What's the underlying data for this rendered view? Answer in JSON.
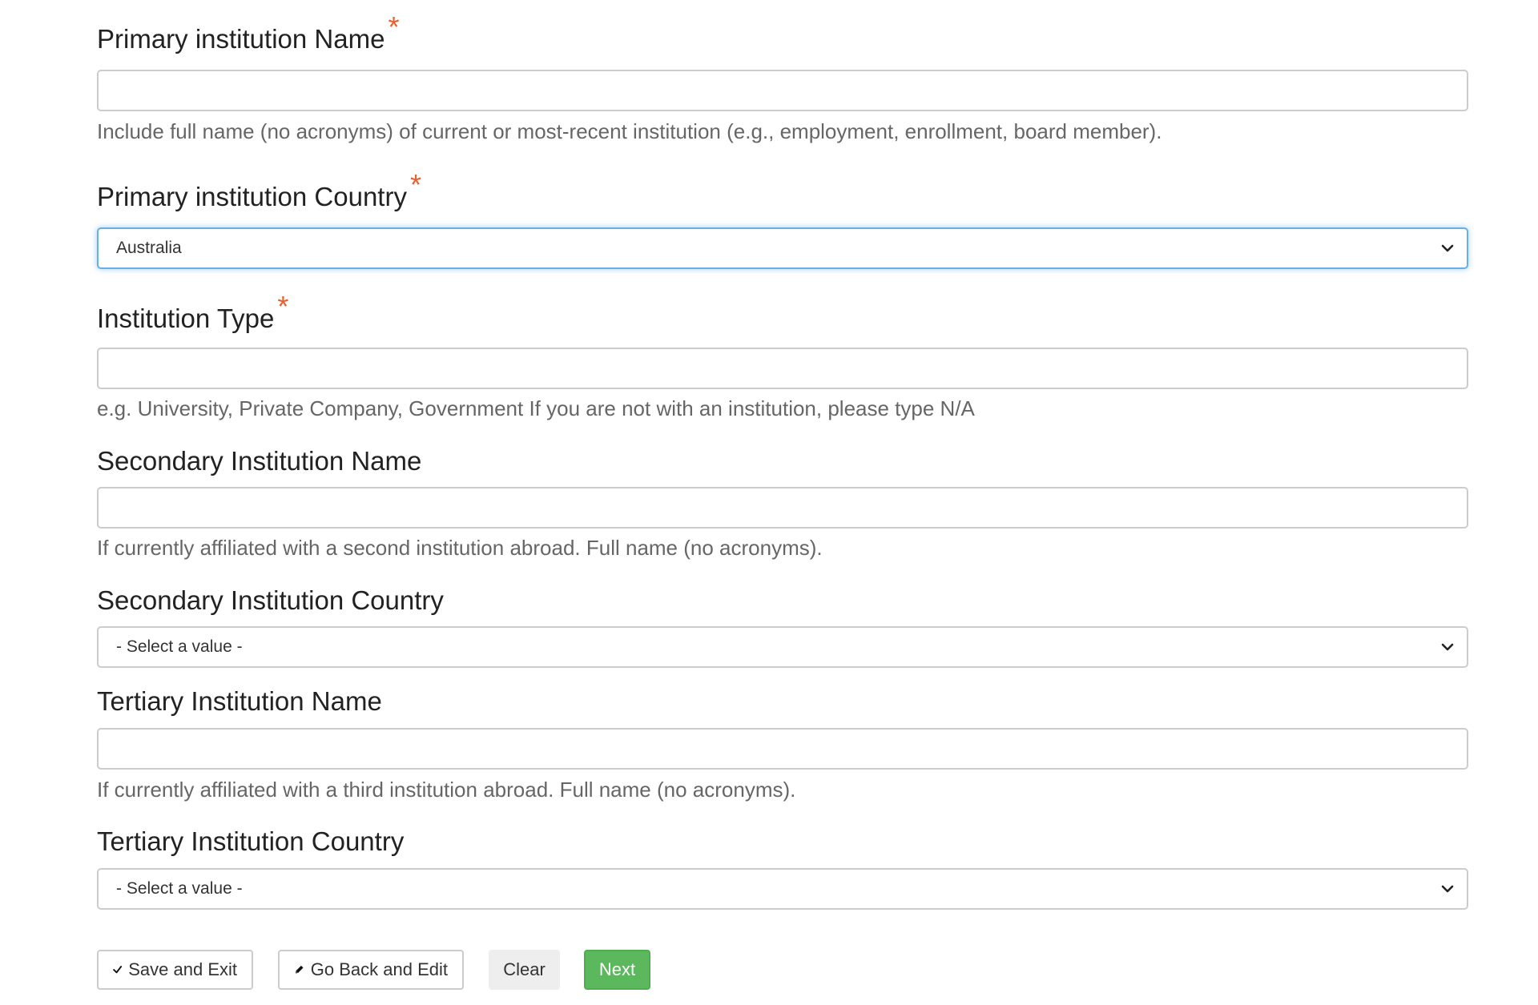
{
  "required_mark": "*",
  "fields": {
    "primary_name": {
      "label": "Primary institution Name",
      "value": "",
      "help": "Include full name (no acronyms) of current or most-recent institution (e.g., employment, enrollment, board member)."
    },
    "primary_country": {
      "label": "Primary institution Country",
      "selected": "Australia"
    },
    "institution_type": {
      "label": "Institution Type",
      "value": "",
      "help": "e.g. University, Private Company, Government If you are not with an institution, please type N/A"
    },
    "secondary_name": {
      "label": "Secondary Institution Name",
      "value": "",
      "help": "If currently affiliated with a second institution abroad. Full name (no acronyms)."
    },
    "secondary_country": {
      "label": "Secondary Institution Country",
      "selected": "- Select a value -"
    },
    "tertiary_name": {
      "label": "Tertiary Institution Name",
      "value": "",
      "help": "If currently affiliated with a third institution abroad. Full name (no acronyms)."
    },
    "tertiary_country": {
      "label": "Tertiary Institution Country",
      "selected": "- Select a value -"
    }
  },
  "buttons": {
    "save_exit": "Save and Exit",
    "go_back": "Go Back and Edit",
    "clear": "Clear",
    "next": "Next"
  },
  "colors": {
    "required": "#e8602c",
    "focus": "#66afe9",
    "success": "#5cb85c"
  },
  "icons": {
    "save_exit": "check-icon",
    "go_back": "pencil-icon",
    "select": "chevron-down-icon"
  }
}
